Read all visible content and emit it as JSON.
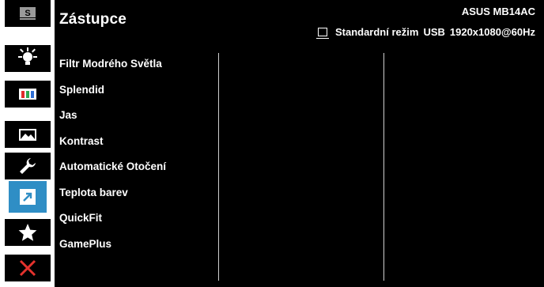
{
  "header": {
    "title": "Zástupce",
    "model": "ASUS MB14AC",
    "status": {
      "mode": "Standardní režim",
      "input": "USB",
      "resolution": "1920x1080@60Hz"
    }
  },
  "sidebar": {
    "items": [
      {
        "icon": "splendid-s-icon",
        "active": false
      },
      {
        "icon": "blue-light-icon",
        "active": false
      },
      {
        "icon": "color-bars-icon",
        "active": false
      },
      {
        "icon": "image-icon",
        "active": false
      },
      {
        "icon": "wrench-icon",
        "active": false
      },
      {
        "icon": "shortcut-arrow-icon",
        "active": true
      },
      {
        "icon": "star-icon",
        "active": false
      },
      {
        "icon": "close-x-icon",
        "active": false
      }
    ]
  },
  "menu": {
    "items": [
      "Filtr Modrého Světla",
      "Splendid",
      "Jas",
      "Kontrast",
      "Automatické Otočení",
      "Teplota barev",
      "QuickFit",
      "GamePlus"
    ]
  },
  "colors": {
    "background": "#000000",
    "accent": "#2f8ec5",
    "close_red": "#e5322d",
    "divider": "#cfcfcf",
    "bar_red": "#e12b2b",
    "bar_green": "#2fa84f",
    "bar_blue": "#2f6fd4"
  }
}
